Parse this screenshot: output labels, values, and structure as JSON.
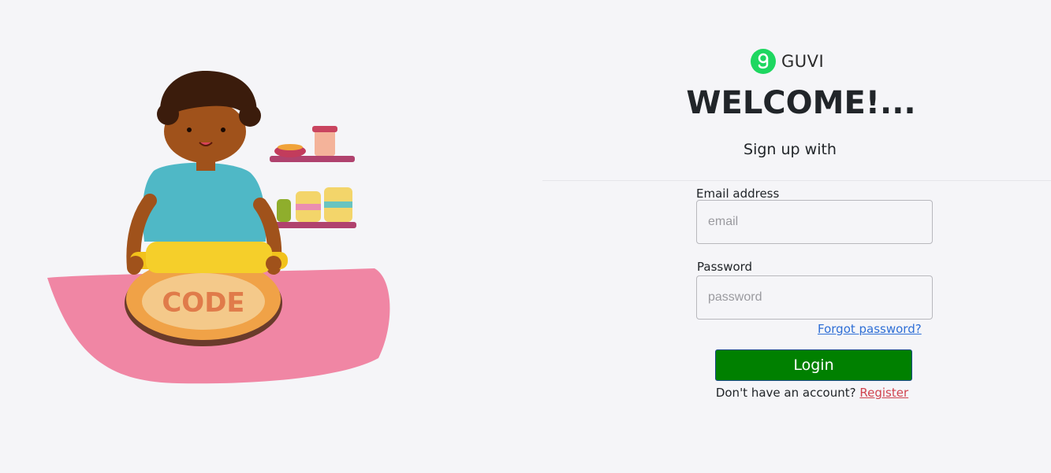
{
  "brand": {
    "name": "GUVI",
    "logo_icon": "guvi-logo-icon",
    "logo_color": "#1ed760"
  },
  "header": {
    "title": "WELCOME!...",
    "subtitle": "Sign up with"
  },
  "form": {
    "email": {
      "label": "Email address",
      "placeholder": "email",
      "value": ""
    },
    "password": {
      "label": "Password",
      "placeholder": "password",
      "value": ""
    },
    "forgot_label": "Forgot password?",
    "login_label": "Login",
    "login_color": "#008000",
    "register_prompt": "Don't have an account?",
    "register_label": "Register"
  },
  "illustration": {
    "icon": "child-baking-illustration",
    "dough_text": "CODE"
  }
}
